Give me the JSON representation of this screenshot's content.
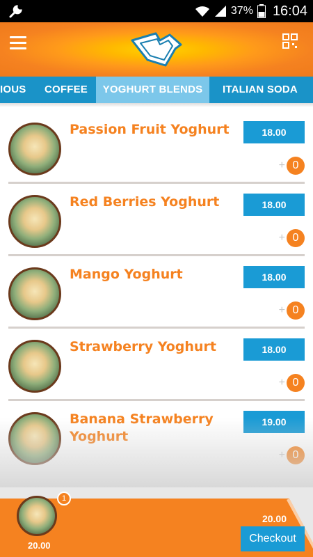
{
  "status_bar": {
    "battery": "37%",
    "time": "16:04"
  },
  "tabs": [
    {
      "label": "IOUS",
      "active": false
    },
    {
      "label": "COFFEE",
      "active": false
    },
    {
      "label": "YOGHURT BLENDS",
      "active": true
    },
    {
      "label": "ITALIAN SODA",
      "active": false
    }
  ],
  "products": [
    {
      "name": "Passion Fruit Yoghurt",
      "price": "18.00",
      "plus": "+",
      "qty": "0"
    },
    {
      "name": "Red Berries Yoghurt",
      "price": "18.00",
      "plus": "+",
      "qty": "0"
    },
    {
      "name": "Mango Yoghurt",
      "price": "18.00",
      "plus": "+",
      "qty": "0"
    },
    {
      "name": "Strawberry Yoghurt",
      "price": "18.00",
      "plus": "+",
      "qty": "0"
    },
    {
      "name": "Banana Strawberry Yoghurt",
      "price": "19.00",
      "plus": "+",
      "qty": "0"
    }
  ],
  "cart": {
    "item_count": "1",
    "item_price": "20.00",
    "total": "20.00",
    "checkout_label": "Checkout"
  },
  "colors": {
    "accent_orange": "#f58220",
    "tab_blue": "#1a93c8",
    "tab_active": "#7cc7ea",
    "price_blue": "#1a9bd5",
    "divider": "#d6d0cc"
  },
  "icons": [
    "wrench-icon",
    "wifi-icon",
    "signal-icon",
    "battery-icon",
    "menu-icon",
    "logo-icon",
    "qr-icon"
  ]
}
